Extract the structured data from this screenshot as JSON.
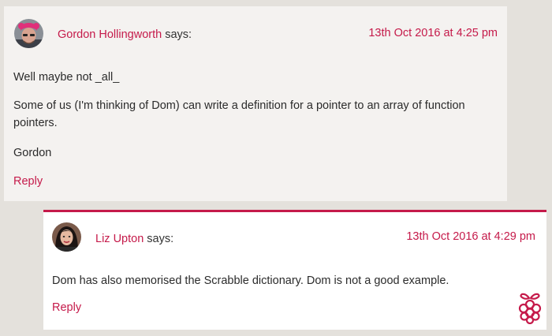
{
  "comments": [
    {
      "author": "Gordon Hollingworth",
      "says": "says:",
      "date": "13th Oct 2016 at 4:25 pm",
      "paragraphs": [
        "Well maybe not _all_",
        "Some of us (I'm thinking of Dom) can write a definition for a pointer to an array of function pointers.",
        "Gordon"
      ],
      "reply_label": "Reply"
    },
    {
      "author": "Liz Upton",
      "says": "says:",
      "date": "13th Oct 2016 at 4:29 pm",
      "paragraphs": [
        "Dom has also memorised the Scrabble dictionary. Dom is not a good example."
      ],
      "reply_label": "Reply"
    }
  ],
  "colors": {
    "accent": "#c51a4a",
    "page_background": "#e4e1dc",
    "comment_background": "#f4f2f0",
    "reply_background": "#ffffff"
  },
  "icons": {
    "gordon_avatar": "avatar-photo",
    "liz_avatar": "avatar-photo",
    "staff_badge": "raspberry-pi-logo-icon"
  }
}
